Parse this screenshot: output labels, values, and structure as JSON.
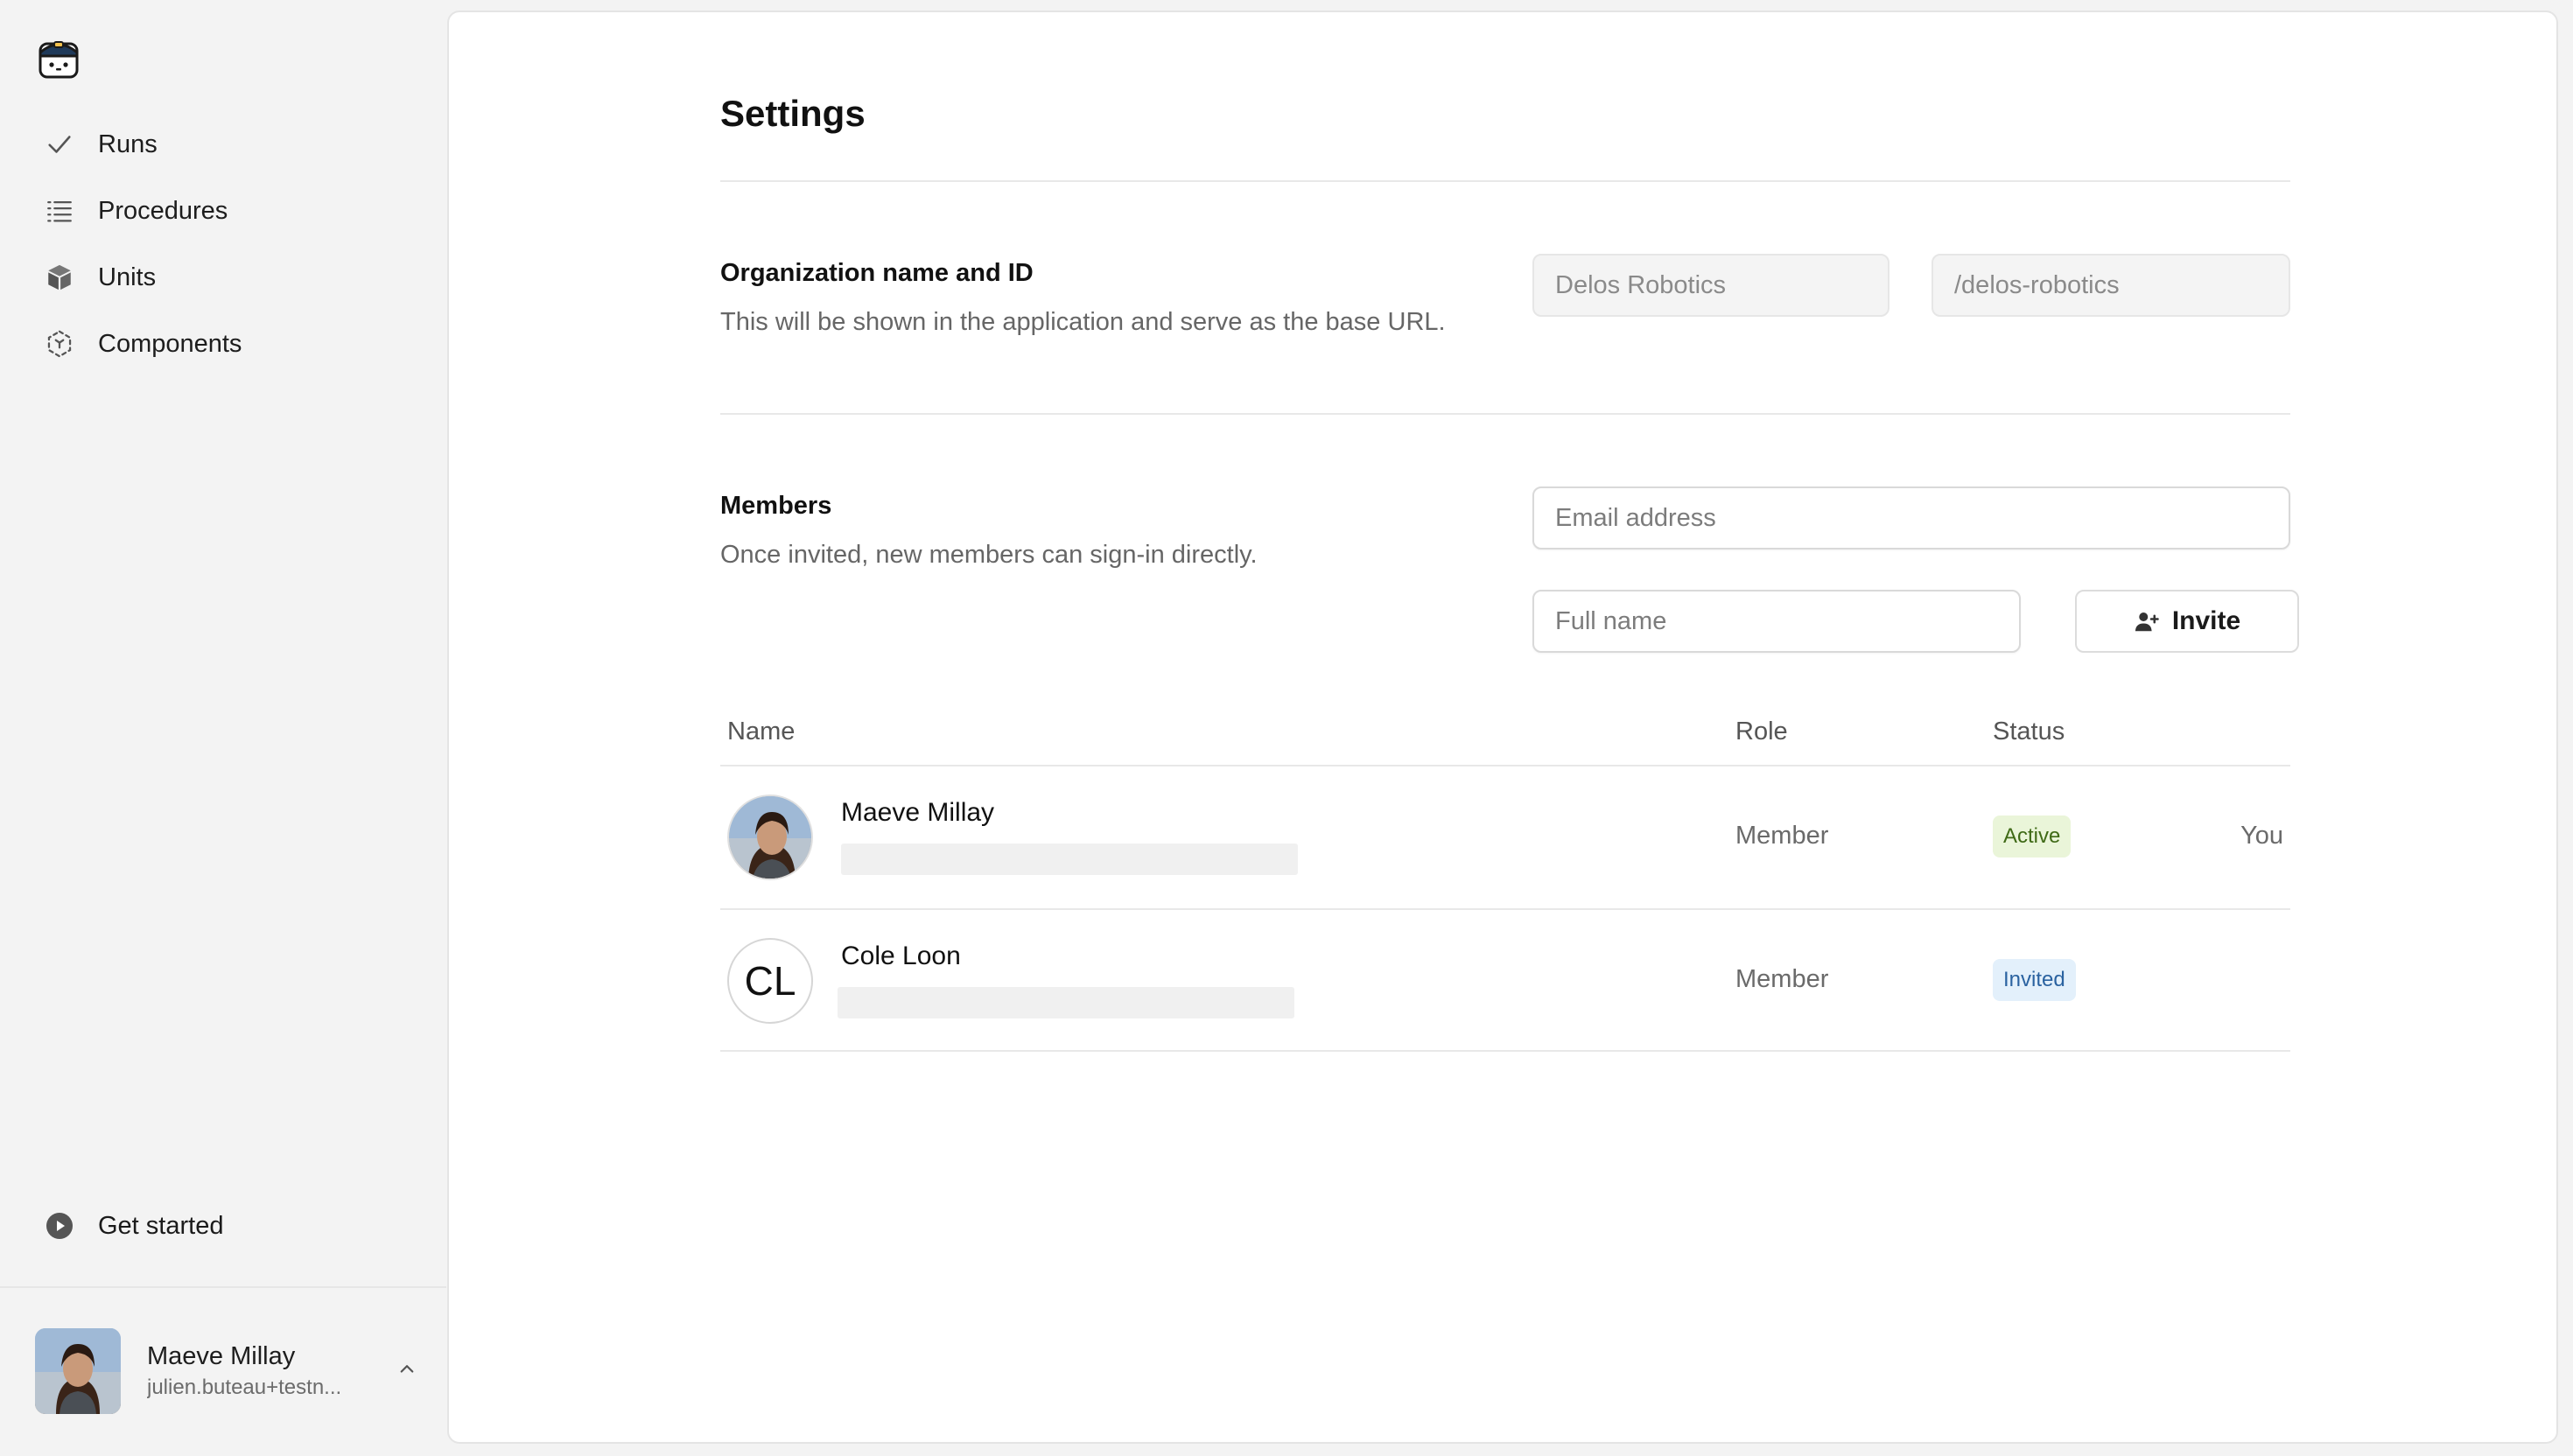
{
  "sidebar": {
    "nav": [
      {
        "label": "Runs",
        "icon": "check-icon"
      },
      {
        "label": "Procedures",
        "icon": "list-icon"
      },
      {
        "label": "Units",
        "icon": "cube-icon"
      },
      {
        "label": "Components",
        "icon": "component-icon"
      }
    ],
    "get_started": "Get started",
    "user": {
      "name": "Maeve Millay",
      "email": "julien.buteau+testn..."
    }
  },
  "main": {
    "title": "Settings",
    "org": {
      "title": "Organization name and ID",
      "description": "This will be shown in the application and serve as the base URL.",
      "name_placeholder": "Delos Robotics",
      "id_placeholder": "/delos-robotics"
    },
    "members": {
      "title": "Members",
      "description": "Once invited, new members can sign-in directly.",
      "email_placeholder": "Email address",
      "name_placeholder": "Full name",
      "invite_label": "Invite"
    },
    "table": {
      "headers": {
        "name": "Name",
        "role": "Role",
        "status": "Status"
      },
      "rows": [
        {
          "name": "Maeve Millay",
          "role": "Member",
          "status": "Active",
          "note": "You"
        },
        {
          "name": "Cole Loon",
          "initials": "CL",
          "role": "Member",
          "status": "Invited"
        }
      ]
    }
  },
  "colors": {
    "active_badge_bg": "#eaf5d9",
    "active_badge_text": "#3f6a16",
    "invited_badge_bg": "#e3f0fb",
    "invited_badge_text": "#2a62a0"
  }
}
